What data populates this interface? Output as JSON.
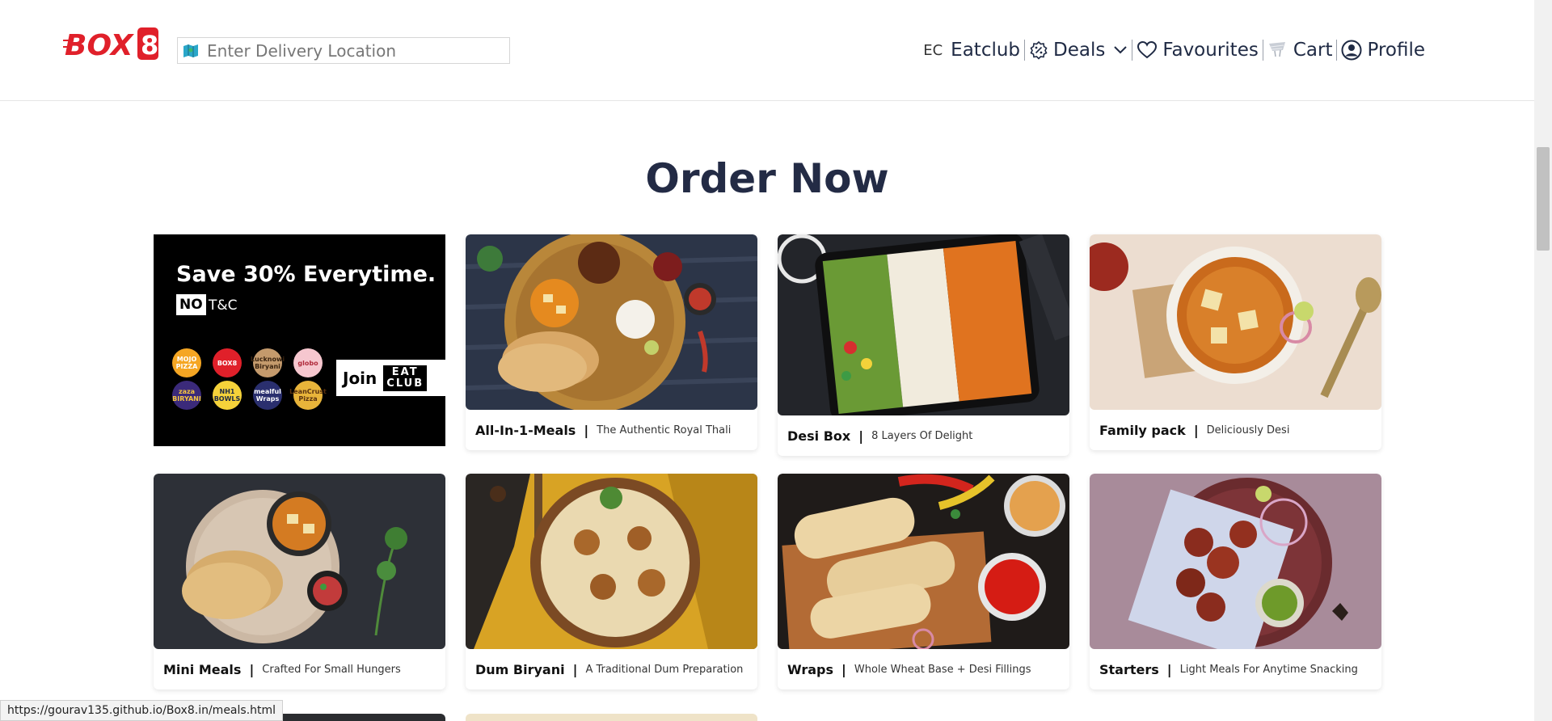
{
  "header": {
    "logo": "BOX8",
    "location_placeholder": "Enter Delivery Location",
    "nav": {
      "ec": "EC",
      "eatclub": "Eatclub",
      "deals": "Deals",
      "favourites": "Favourites",
      "cart": "Cart",
      "profile": "Profile"
    }
  },
  "page_title": "Order Now",
  "promo": {
    "headline": "Save 30% Everytime.",
    "no": "NO",
    "tc": "T&C",
    "join": "Join",
    "eatclub_line1": "EAT",
    "eatclub_line2": "CLUB",
    "brands": [
      "MOJO PIZZA",
      "BOX8",
      "Lucknowi Biryani",
      "globo",
      "zaza BIRYANI",
      "NH1 BOWLS",
      "mealful Wraps",
      "LeanCrust Pizza"
    ]
  },
  "cards": [
    {
      "title": "All-In-1-Meals",
      "subtitle": "The Authentic Royal Thali"
    },
    {
      "title": "Desi Box",
      "subtitle": "8 Layers Of Delight"
    },
    {
      "title": "Family pack",
      "subtitle": "Deliciously Desi"
    },
    {
      "title": "Mini Meals",
      "subtitle": "Crafted For Small Hungers"
    },
    {
      "title": "Dum Biryani",
      "subtitle": "A Traditional Dum Preparation"
    },
    {
      "title": "Wraps",
      "subtitle": "Whole Wheat Base + Desi Fillings"
    },
    {
      "title": "Starters",
      "subtitle": "Light Meals For Anytime Snacking"
    }
  ],
  "status_url": "https://gourav135.github.io/Box8.in/meals.html",
  "colors": {
    "brand_red": "#e0202a",
    "title_navy": "#232b45"
  }
}
